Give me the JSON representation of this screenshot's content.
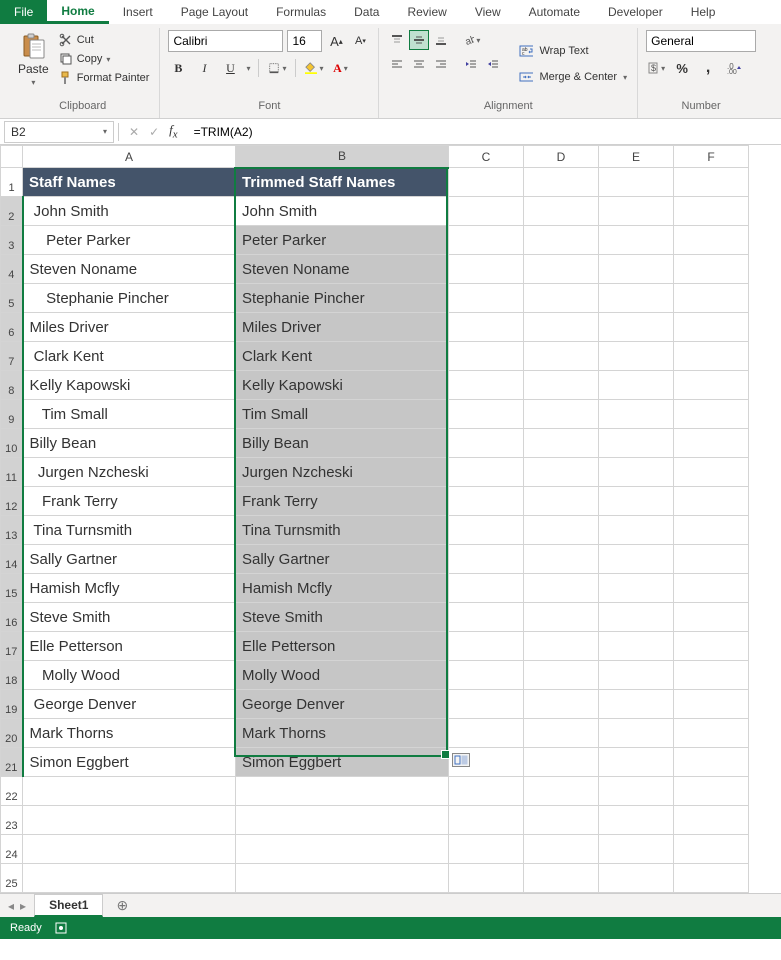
{
  "tabs": [
    "File",
    "Home",
    "Insert",
    "Page Layout",
    "Formulas",
    "Data",
    "Review",
    "View",
    "Automate",
    "Developer",
    "Help"
  ],
  "activeTab": "Home",
  "ribbon": {
    "clipboard": {
      "paste": "Paste",
      "cut": "Cut",
      "copy": "Copy",
      "format_painter": "Format Painter",
      "label": "Clipboard"
    },
    "font": {
      "name": "Calibri",
      "size": "16",
      "label": "Font"
    },
    "alignment": {
      "wrap": "Wrap Text",
      "merge": "Merge & Center",
      "label": "Alignment"
    },
    "number": {
      "format": "General",
      "label": "Number"
    }
  },
  "namebox": "B2",
  "formula": "=TRIM(A2)",
  "columns": [
    "A",
    "B",
    "C",
    "D",
    "E",
    "F"
  ],
  "header_row": [
    "Staff Names",
    "Trimmed Staff Names"
  ],
  "data_rows": [
    [
      " John Smith",
      "John Smith"
    ],
    [
      "    Peter Parker",
      "Peter Parker"
    ],
    [
      "Steven Noname",
      "Steven Noname"
    ],
    [
      "    Stephanie Pincher",
      "Stephanie Pincher"
    ],
    [
      "Miles Driver",
      "Miles Driver"
    ],
    [
      " Clark Kent",
      "Clark Kent"
    ],
    [
      "Kelly Kapowski",
      "Kelly Kapowski"
    ],
    [
      "   Tim Small",
      "Tim Small"
    ],
    [
      "Billy Bean",
      "Billy Bean"
    ],
    [
      "  Jurgen Nzcheski",
      "Jurgen Nzcheski"
    ],
    [
      "   Frank Terry",
      "Frank Terry"
    ],
    [
      " Tina Turnsmith",
      "Tina Turnsmith"
    ],
    [
      "Sally Gartner",
      "Sally Gartner"
    ],
    [
      "Hamish Mcfly",
      "Hamish Mcfly"
    ],
    [
      "Steve Smith",
      "Steve Smith"
    ],
    [
      "Elle Petterson",
      "Elle Petterson"
    ],
    [
      "   Molly Wood",
      "Molly Wood"
    ],
    [
      " George Denver",
      "George Denver"
    ],
    [
      "Mark Thorns",
      "Mark Thorns"
    ],
    [
      "Simon Eggbert",
      "Simon Eggbert"
    ]
  ],
  "empty_rows": [
    22,
    23,
    24,
    25
  ],
  "sheet_name": "Sheet1",
  "status_text": "Ready"
}
